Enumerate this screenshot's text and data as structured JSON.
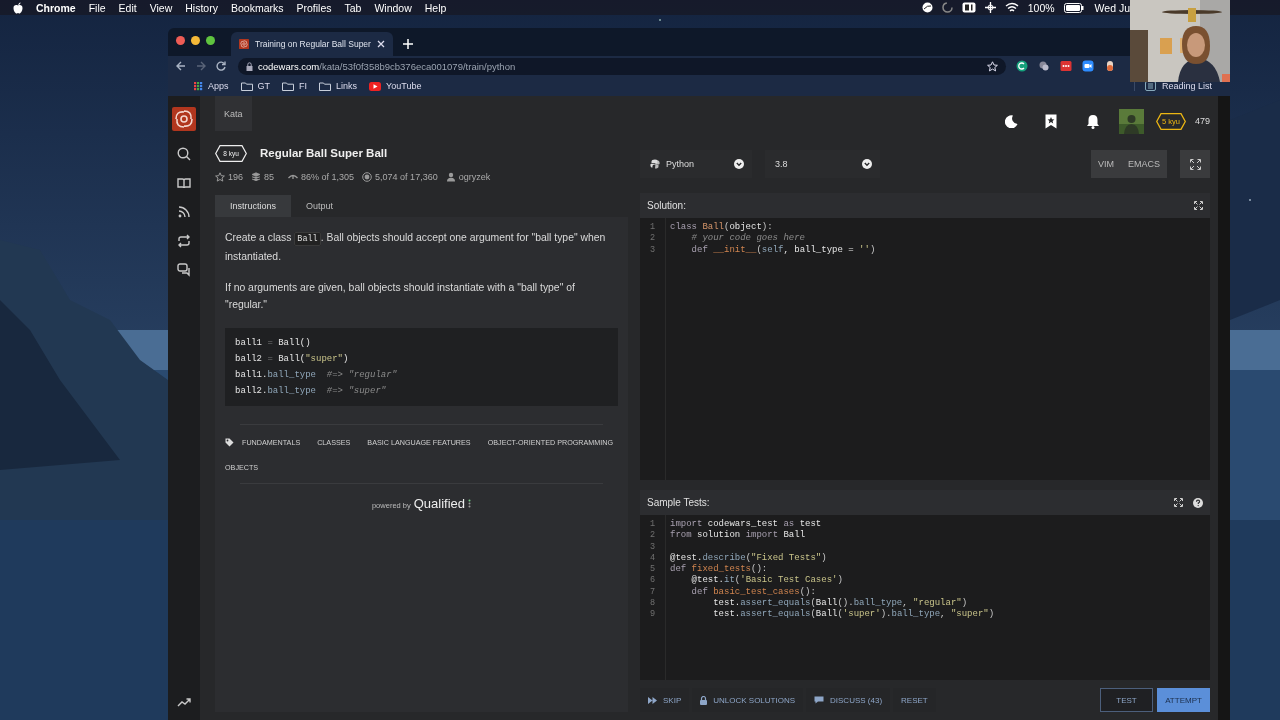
{
  "menu_bar": {
    "app": "Chrome",
    "menus": [
      "File",
      "Edit",
      "View",
      "History",
      "Bookmarks",
      "Profiles",
      "Tab",
      "Window",
      "Help"
    ],
    "battery": "100%",
    "clock": "Wed Ju"
  },
  "browser": {
    "tab_title": "Training on Regular Ball Super",
    "address": {
      "host": "codewars.com",
      "path": "/kata/53f0f358b9cb376eca001079/train/python"
    },
    "bookmarks": [
      {
        "label": "Apps",
        "kind": "apps"
      },
      {
        "label": "GT",
        "kind": "folder"
      },
      {
        "label": "FI",
        "kind": "folder"
      },
      {
        "label": "Links",
        "kind": "folder"
      },
      {
        "label": "YouTube",
        "kind": "video"
      }
    ],
    "reading_list": "Reading List"
  },
  "nav": {
    "section": "Kata",
    "rank": "5 kyu",
    "honor": "479"
  },
  "kata": {
    "rank": "8 kyu",
    "title": "Regular Ball Super Ball",
    "stats": [
      {
        "kind": "stars",
        "text": "196"
      },
      {
        "kind": "collections",
        "text": "85"
      },
      {
        "kind": "satisfaction",
        "text": "86% of 1,305"
      },
      {
        "kind": "completions",
        "text": "5,074 of 17,360"
      },
      {
        "kind": "author",
        "text": "ogryzek"
      }
    ],
    "tabs": [
      {
        "label": "Instructions",
        "selected": true
      },
      {
        "label": "Output",
        "selected": false
      }
    ],
    "paragraphs": [
      {
        "parts": [
          {
            "text": "Create a class "
          },
          {
            "code": "Ball"
          },
          {
            "text": ". Ball objects should accept one argument for \"ball type\" when instantiated."
          }
        ]
      },
      {
        "parts": [
          {
            "text": "If no arguments are given, ball objects should instantiate with a \"ball type\" of \"regular.\""
          }
        ]
      }
    ],
    "example": [
      [
        {
          "text": "ball1 ",
          "kind": "plain"
        },
        {
          "text": "=",
          "kind": "operator"
        },
        {
          "text": " Ball()",
          "kind": "plain"
        }
      ],
      [
        {
          "text": "ball2 ",
          "kind": "plain"
        },
        {
          "text": "=",
          "kind": "operator"
        },
        {
          "text": " Ball(",
          "kind": "plain"
        },
        {
          "text": "\"super\"",
          "kind": "string"
        },
        {
          "text": ")",
          "kind": "plain"
        }
      ],
      [
        {
          "text": "ball1.",
          "kind": "plain"
        },
        {
          "text": "ball_type",
          "kind": "attribute"
        },
        {
          "text": "  #=> \"regular\"",
          "kind": "comment"
        }
      ],
      [
        {
          "text": "ball2.",
          "kind": "plain"
        },
        {
          "text": "ball_type",
          "kind": "attribute"
        },
        {
          "text": "  #=> \"super\"",
          "kind": "comment"
        }
      ]
    ],
    "tags": [
      "FUNDAMENTALS",
      "CLASSES",
      "BASIC LANGUAGE FEATURES",
      "OBJECT-ORIENTED PROGRAMMING",
      "OBJECTS"
    ],
    "footer": {
      "prefix": "powered by",
      "brand": "Qualified"
    }
  },
  "editor": {
    "language": "Python",
    "version": "3.8",
    "keymaps": [
      "VIM",
      "EMACS"
    ]
  },
  "solution": {
    "title": "Solution:",
    "lines": [
      {
        "number": "1",
        "tokens": [
          {
            "text": "class ",
            "kind": "keyword"
          },
          {
            "text": "Ball",
            "kind": "name"
          },
          {
            "text": "(",
            "kind": "punctuation"
          },
          {
            "text": "object",
            "kind": "plain"
          },
          {
            "text": "):",
            "kind": "punctuation"
          }
        ]
      },
      {
        "number": "2",
        "tokens": [
          {
            "text": "    # your code goes here",
            "kind": "comment"
          }
        ]
      },
      {
        "number": "3",
        "tokens": [
          {
            "text": "    def ",
            "kind": "keyword"
          },
          {
            "text": "__init__",
            "kind": "function"
          },
          {
            "text": "(",
            "kind": "punctuation"
          },
          {
            "text": "self",
            "kind": "attribute"
          },
          {
            "text": ", ball_type = ",
            "kind": "plain"
          },
          {
            "text": "''",
            "kind": "string"
          },
          {
            "text": ")",
            "kind": "punctuation"
          }
        ]
      }
    ]
  },
  "sample_tests": {
    "title": "Sample Tests:",
    "help": true,
    "lines": [
      {
        "number": "1",
        "tokens": [
          {
            "text": "import",
            "kind": "keyword"
          },
          {
            "text": " codewars_test ",
            "kind": "plain"
          },
          {
            "text": "as",
            "kind": "keyword"
          },
          {
            "text": " test",
            "kind": "plain"
          }
        ]
      },
      {
        "number": "2",
        "tokens": [
          {
            "text": "from",
            "kind": "keyword"
          },
          {
            "text": " solution ",
            "kind": "plain"
          },
          {
            "text": "import",
            "kind": "keyword"
          },
          {
            "text": " Ball",
            "kind": "plain"
          }
        ]
      },
      {
        "number": "3"
      },
      {
        "number": "4",
        "tokens": [
          {
            "text": "@test.",
            "kind": "plain"
          },
          {
            "text": "describe",
            "kind": "attribute"
          },
          {
            "text": "(",
            "kind": "punctuation"
          },
          {
            "text": "\"Fixed Tests\"",
            "kind": "string"
          },
          {
            "text": ")",
            "kind": "punctuation"
          }
        ]
      },
      {
        "number": "5",
        "tokens": [
          {
            "text": "def ",
            "kind": "keyword"
          },
          {
            "text": "fixed_tests",
            "kind": "function"
          },
          {
            "text": "():",
            "kind": "punctuation"
          }
        ]
      },
      {
        "number": "6",
        "tokens": [
          {
            "text": "    @test.",
            "kind": "plain"
          },
          {
            "text": "it",
            "kind": "attribute"
          },
          {
            "text": "(",
            "kind": "punctuation"
          },
          {
            "text": "'Basic Test Cases'",
            "kind": "string"
          },
          {
            "text": ")",
            "kind": "punctuation"
          }
        ]
      },
      {
        "number": "7",
        "tokens": [
          {
            "text": "    def ",
            "kind": "keyword"
          },
          {
            "text": "basic_test_cases",
            "kind": "function"
          },
          {
            "text": "():",
            "kind": "punctuation"
          }
        ]
      },
      {
        "number": "8",
        "tokens": [
          {
            "text": "        test.",
            "kind": "plain"
          },
          {
            "text": "assert_equals",
            "kind": "attribute"
          },
          {
            "text": "(",
            "kind": "punctuation"
          },
          {
            "text": "Ball",
            "kind": "plain"
          },
          {
            "text": "().",
            "kind": "punctuation"
          },
          {
            "text": "ball_type",
            "kind": "attribute"
          },
          {
            "text": ", ",
            "kind": "punctuation"
          },
          {
            "text": "\"regular\"",
            "kind": "string"
          },
          {
            "text": ")",
            "kind": "punctuation"
          }
        ]
      },
      {
        "number": "9",
        "tokens": [
          {
            "text": "        test.",
            "kind": "plain"
          },
          {
            "text": "assert_equals",
            "kind": "attribute"
          },
          {
            "text": "(",
            "kind": "punctuation"
          },
          {
            "text": "Ball",
            "kind": "plain"
          },
          {
            "text": "(",
            "kind": "punctuation"
          },
          {
            "text": "'super'",
            "kind": "string"
          },
          {
            "text": ").",
            "kind": "punctuation"
          },
          {
            "text": "ball_type",
            "kind": "attribute"
          },
          {
            "text": ", ",
            "kind": "punctuation"
          },
          {
            "text": "\"super\"",
            "kind": "string"
          },
          {
            "text": ")",
            "kind": "punctuation"
          }
        ]
      }
    ]
  },
  "actions": [
    {
      "label": "SKIP",
      "kind": "skip"
    },
    {
      "label": "UNLOCK SOLUTIONS",
      "kind": "unlock"
    },
    {
      "label": "DISCUSS (43)",
      "kind": "discuss"
    },
    {
      "label": "RESET",
      "kind": "reset"
    },
    {
      "label": "TEST",
      "kind": "test"
    },
    {
      "label": "ATTEMPT",
      "kind": "attempt"
    }
  ]
}
